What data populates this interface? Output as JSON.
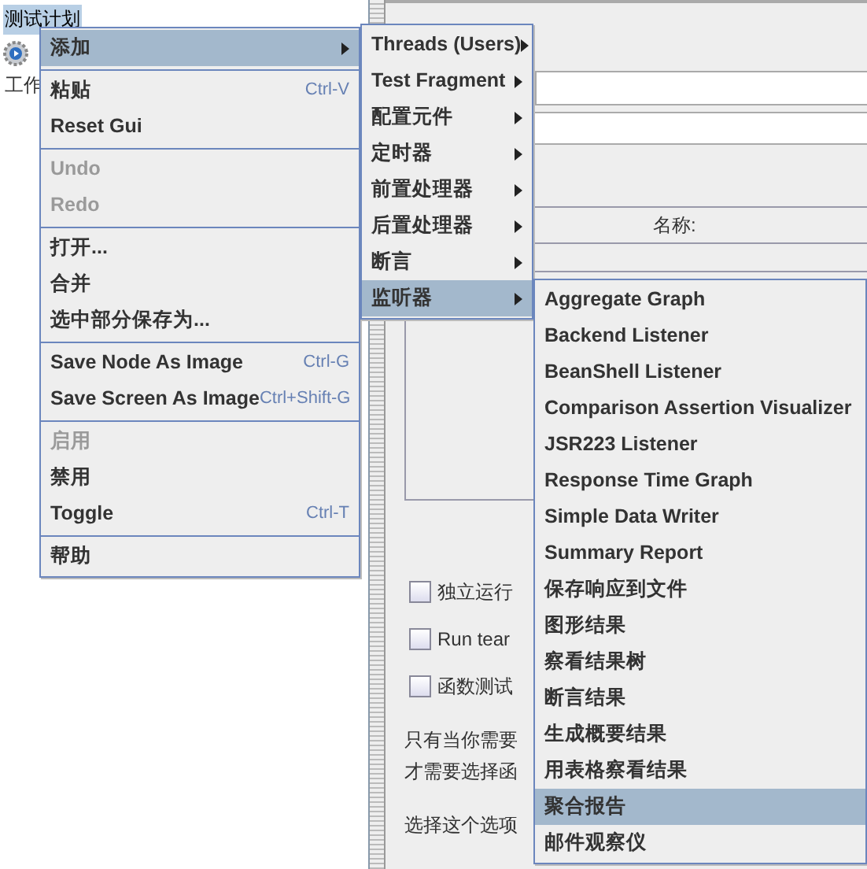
{
  "tree": [
    {
      "kind": "label",
      "label": "测试计划",
      "selected": true
    },
    {
      "kind": "gear"
    },
    {
      "kind": "label",
      "label": "工作",
      "selected": false
    }
  ],
  "editor": {
    "name_header": "名称:",
    "checkboxes": [
      {
        "label": "独立运行",
        "checked": false
      },
      {
        "label": "Run tear",
        "checked": false
      },
      {
        "label": "函数测试",
        "checked": false
      }
    ],
    "notes": [
      "只有当你需要",
      "才需要选择函",
      "选择这个选项"
    ]
  },
  "context_menu": [
    {
      "kind": "item",
      "label": "添加",
      "submenu": true,
      "selected": true,
      "disabled": false
    },
    {
      "kind": "separator"
    },
    {
      "kind": "item",
      "label": "粘贴",
      "shortcut": "Ctrl-V",
      "selected": false,
      "disabled": false
    },
    {
      "kind": "item",
      "label": "Reset Gui",
      "selected": false,
      "disabled": false
    },
    {
      "kind": "separator"
    },
    {
      "kind": "item",
      "label": "Undo",
      "selected": false,
      "disabled": true
    },
    {
      "kind": "item",
      "label": "Redo",
      "selected": false,
      "disabled": true
    },
    {
      "kind": "separator"
    },
    {
      "kind": "item",
      "label": "打开...",
      "selected": false,
      "disabled": false
    },
    {
      "kind": "item",
      "label": "合并",
      "selected": false,
      "disabled": false
    },
    {
      "kind": "item",
      "label": "选中部分保存为...",
      "selected": false,
      "disabled": false
    },
    {
      "kind": "separator"
    },
    {
      "kind": "item",
      "label": "Save Node As Image",
      "shortcut": "Ctrl-G",
      "selected": false,
      "disabled": false
    },
    {
      "kind": "item",
      "label": "Save Screen As Image",
      "shortcut": "Ctrl+Shift-G",
      "selected": false,
      "disabled": false
    },
    {
      "kind": "separator"
    },
    {
      "kind": "item",
      "label": "启用",
      "selected": false,
      "disabled": true
    },
    {
      "kind": "item",
      "label": "禁用",
      "selected": false,
      "disabled": false
    },
    {
      "kind": "item",
      "label": "Toggle",
      "shortcut": "Ctrl-T",
      "selected": false,
      "disabled": false
    },
    {
      "kind": "separator"
    },
    {
      "kind": "item",
      "label": "帮助",
      "selected": false,
      "disabled": false
    }
  ],
  "add_submenu": [
    {
      "kind": "item",
      "label": "Threads (Users)",
      "submenu": true,
      "selected": false
    },
    {
      "kind": "item",
      "label": "Test Fragment",
      "submenu": true,
      "selected": false
    },
    {
      "kind": "item",
      "label": "配置元件",
      "submenu": true,
      "selected": false
    },
    {
      "kind": "item",
      "label": "定时器",
      "submenu": true,
      "selected": false
    },
    {
      "kind": "item",
      "label": "前置处理器",
      "submenu": true,
      "selected": false
    },
    {
      "kind": "item",
      "label": "后置处理器",
      "submenu": true,
      "selected": false
    },
    {
      "kind": "item",
      "label": "断言",
      "submenu": true,
      "selected": false
    },
    {
      "kind": "item",
      "label": "监听器",
      "submenu": true,
      "selected": true
    }
  ],
  "listener_submenu": [
    {
      "kind": "item",
      "label": "Aggregate Graph",
      "selected": false
    },
    {
      "kind": "item",
      "label": "Backend Listener",
      "selected": false
    },
    {
      "kind": "item",
      "label": "BeanShell Listener",
      "selected": false
    },
    {
      "kind": "item",
      "label": "Comparison Assertion Visualizer",
      "selected": false
    },
    {
      "kind": "item",
      "label": "JSR223 Listener",
      "selected": false
    },
    {
      "kind": "item",
      "label": "Response Time Graph",
      "selected": false
    },
    {
      "kind": "item",
      "label": "Simple Data Writer",
      "selected": false
    },
    {
      "kind": "item",
      "label": "Summary Report",
      "selected": false
    },
    {
      "kind": "item",
      "label": "保存响应到文件",
      "selected": false
    },
    {
      "kind": "item",
      "label": "图形结果",
      "selected": false
    },
    {
      "kind": "item",
      "label": "察看结果树",
      "selected": false
    },
    {
      "kind": "item",
      "label": "断言结果",
      "selected": false
    },
    {
      "kind": "item",
      "label": "生成概要结果",
      "selected": false
    },
    {
      "kind": "item",
      "label": "用表格察看结果",
      "selected": false
    },
    {
      "kind": "item",
      "label": "聚合报告",
      "selected": true
    },
    {
      "kind": "item",
      "label": "邮件观察仪",
      "selected": false
    }
  ]
}
